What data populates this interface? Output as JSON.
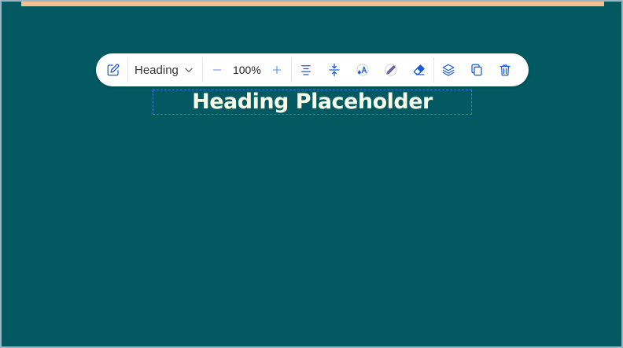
{
  "colors": {
    "canvas": "#025961",
    "top_strip": "#f2c08e",
    "accent": "#1a5dd6",
    "heading_text": "#f7fbe6",
    "selection_outline": "#2d7de0"
  },
  "toolbar": {
    "edit_icon": "pencil-icon",
    "text_style": {
      "value": "Heading"
    },
    "zoom": {
      "value": "100%"
    },
    "icons": [
      "align-center-icon",
      "vertical-spacing-icon",
      "text-color-icon",
      "no-color-icon",
      "eraser-icon",
      "layers-icon",
      "duplicate-icon",
      "trash-icon"
    ]
  },
  "canvas": {
    "heading": "Heading Placeholder"
  }
}
